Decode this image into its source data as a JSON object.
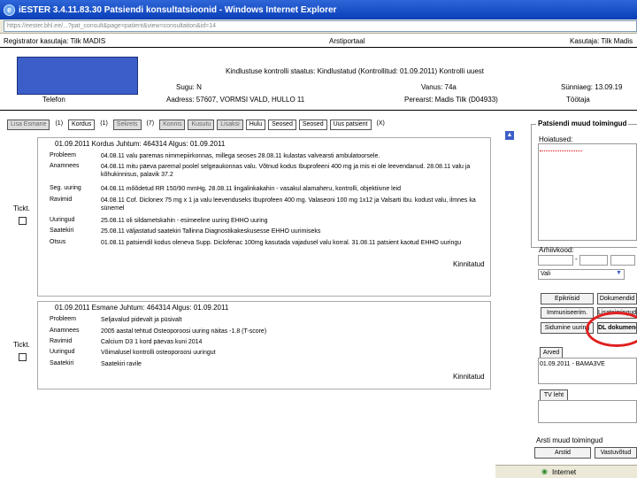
{
  "window": {
    "title": "iESTER 3.4.11.83.30 Patsiendi konsultatsioonid - Windows Internet Explorer"
  },
  "address": {
    "url": "https://eester.bhl.ee/...?pat_consult&page=patient&view=consultation&id=14"
  },
  "topbar": {
    "logged_user": "Registrator kasutaja: Tilk MADIS",
    "center": "Arstiportaal",
    "right": "Kasutaja: Tilk Madis"
  },
  "insurance": {
    "status": "Kindlustuse kontrolli staatus: Kindlustatud (Kontrollitud: 01.09.2011) Kontrolli uuest"
  },
  "patient": {
    "sugu": "Sugu: N",
    "vanus": "Vanus: 74a",
    "synniaeg": "Sünniaeg: 13.09.19",
    "telefon": "Telefon",
    "aadress": "Aadress: 57607, VORMSI VALD, HULLO 11",
    "perearst": "Perearst: Madis Tilk (D04933)",
    "tootjad": "Töötaja"
  },
  "tabs": [
    "Lisa Esmane",
    "(1)",
    "Kordus",
    "(1)",
    "Sekrets",
    "(7)",
    "Konnis",
    "Kusutu",
    "Lisaksi",
    "Hulu",
    "Seosed",
    "Seosed",
    "Uus patsient",
    "(X)"
  ],
  "consult1": {
    "head": "01.09.2011   Kordus   Juhtum: 464314   Algus: 01.09.2011",
    "rows": [
      {
        "label": "Probleem",
        "text": "04.08.11 valu paremas nimmepiirkonnas, millega seoses 28.08.11 kulastas valvearsti ambulatoorsele."
      },
      {
        "label": "Anamnees",
        "text": "04.08.11 mitu päeva paremal poolel selgeaukonnas valu. Võtnud kodus Ibuprofeeni 400 mg ja mis ei ole leevendanud. 28.08.11 valu ja kõhukinnisus, palavik 37.2"
      },
      {
        "label": "Seg. uuring",
        "text": "04.08.11 mõõdetud RR 150/90 mmHg. 28.08.11 lingalinkakahin - vasakul alamaheru, kontrolli, objektiivne leid"
      },
      {
        "label": "Ravimid",
        "text": "04.08.11 Cof. Diclonex 75 mg x 1 ja valu leevenduseks Ibuprofeen 400 mg. Valaseoni 100 mg 1x12 ja Valsarti Ibu. kodust valu, ilmnes ka sünemel"
      },
      {
        "label": "Uuringud",
        "text": "25.08.11 oli sildametskahin - esimeeline uuring EHHO uuring"
      },
      {
        "label": "Saatekiri",
        "text": "25.08.11 väljastatud saatekiri Tallinna Diagnostikakeskusesse EHHO uurimiseks"
      },
      {
        "label": "Otsus",
        "text": "01.08.11 patsiendil kodus oleneva Supp. Diclofenac 100mg kasutada vajadusel valu korral. 31.08.11 patsient kaotud EHHO uuringu"
      }
    ],
    "signed": "Kinnitatud"
  },
  "consult2": {
    "head": "01.09.2011   Esmane   Juhtum: 464314   Algus: 01.09.2011",
    "rows": [
      {
        "label": "Probleem",
        "text": "Seljavalud pidevalt ja püsivalt"
      },
      {
        "label": "Anamnees",
        "text": "2005 aastal tehtud Osteoporoosi uuring näitas -1.8 (T-score)"
      },
      {
        "label": "Ravimid",
        "text": "Calcium D3 1 kord päevas kuni 2014"
      },
      {
        "label": "Uuringud",
        "text": "Võimalusel kontrolli osteoporoosi uuringut"
      },
      {
        "label": "Saatekiri",
        "text": "Saatekiri ravile"
      }
    ],
    "signed": "Kinnitatud"
  },
  "tick_label": "Tickt.",
  "sidebar": {
    "title": "Patsiendi muud toimingud",
    "hoiatused": "Hoiatused:",
    "arhiivkood": "Arhiivkood:",
    "select_value": "Vali",
    "buttons": [
      "Epikriisid",
      "Dokumendid",
      "Immuniseerim.",
      "Lisatoimingud",
      "Sidumine uuring",
      "DL dokumendid"
    ],
    "arved": "Arved",
    "arved_item": "01.09.2011 - BAMA3VE",
    "tv_leht": "TV leht",
    "muud": "Arsti muud toimingud",
    "bottom_buttons": [
      "Arstid",
      "Vastuvõtud"
    ]
  },
  "status": {
    "zone": "Internet"
  }
}
